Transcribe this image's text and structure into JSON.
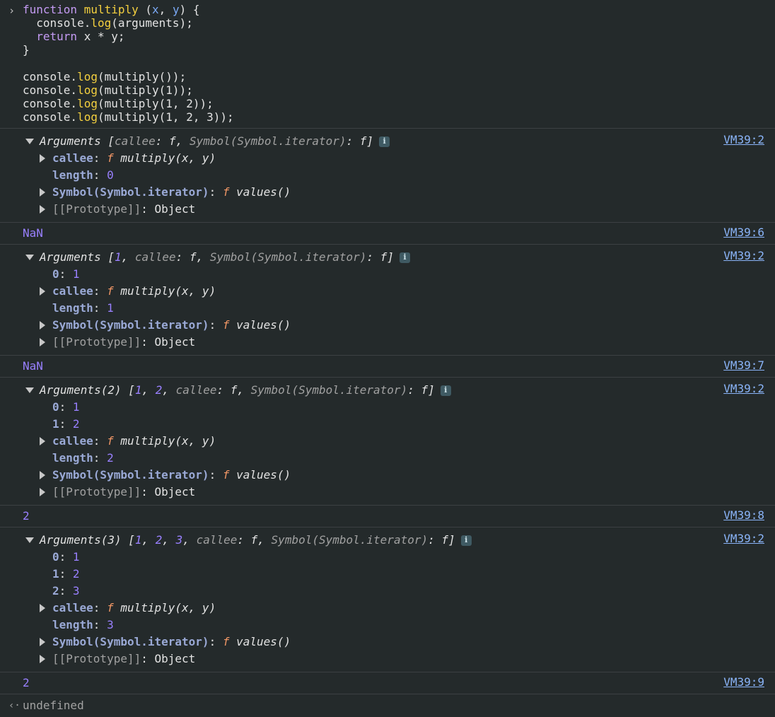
{
  "input": {
    "prompt_glyph": "›",
    "lines": [
      [
        {
          "c": "kw",
          "t": "function "
        },
        {
          "c": "fn",
          "t": "multiply"
        },
        {
          "c": "plain",
          "t": " ("
        },
        {
          "c": "param",
          "t": "x"
        },
        {
          "c": "plain",
          "t": ", "
        },
        {
          "c": "param",
          "t": "y"
        },
        {
          "c": "plain",
          "t": ") {"
        }
      ],
      [
        {
          "c": "plain",
          "t": "  console."
        },
        {
          "c": "fn",
          "t": "log"
        },
        {
          "c": "plain",
          "t": "(arguments);"
        }
      ],
      [
        {
          "c": "plain",
          "t": "  "
        },
        {
          "c": "kw",
          "t": "return"
        },
        {
          "c": "plain",
          "t": " x * y;"
        }
      ],
      [
        {
          "c": "plain",
          "t": "}"
        }
      ],
      [
        {
          "c": "plain",
          "t": ""
        }
      ],
      [
        {
          "c": "plain",
          "t": "console."
        },
        {
          "c": "fn",
          "t": "log"
        },
        {
          "c": "plain",
          "t": "(multiply());"
        }
      ],
      [
        {
          "c": "plain",
          "t": "console."
        },
        {
          "c": "fn",
          "t": "log"
        },
        {
          "c": "plain",
          "t": "(multiply(1));"
        }
      ],
      [
        {
          "c": "plain",
          "t": "console."
        },
        {
          "c": "fn",
          "t": "log"
        },
        {
          "c": "plain",
          "t": "(multiply(1, 2));"
        }
      ],
      [
        {
          "c": "plain",
          "t": "console."
        },
        {
          "c": "fn",
          "t": "log"
        },
        {
          "c": "plain",
          "t": "(multiply(1, 2, 3));"
        }
      ]
    ]
  },
  "strings": {
    "arguments": "Arguments",
    "callee_key": "callee",
    "callee_f": "f",
    "callee_sig": "multiply(x, y)",
    "length_key": "length",
    "symbol_key": "Symbol(Symbol.iterator)",
    "values_f": "f",
    "values_sig": "values()",
    "proto_key": "[[Prototype]]",
    "proto_val": "Object",
    "info": "i"
  },
  "entries": [
    {
      "type": "obj",
      "source": "VM39:2",
      "count_label": "",
      "items": [],
      "length": "0"
    },
    {
      "type": "val",
      "source": "VM39:6",
      "value": "NaN"
    },
    {
      "type": "obj",
      "source": "VM39:2",
      "count_label": "",
      "items": [
        "1"
      ],
      "length": "1"
    },
    {
      "type": "val",
      "source": "VM39:7",
      "value": "NaN"
    },
    {
      "type": "obj",
      "source": "VM39:2",
      "count_label": "(2)",
      "items": [
        "1",
        "2"
      ],
      "length": "2"
    },
    {
      "type": "val",
      "source": "VM39:8",
      "value": "2"
    },
    {
      "type": "obj",
      "source": "VM39:2",
      "count_label": "(3)",
      "items": [
        "1",
        "2",
        "3"
      ],
      "length": "3"
    },
    {
      "type": "val",
      "source": "VM39:9",
      "value": "2"
    }
  ],
  "result": {
    "arrow": "‹·",
    "value": "undefined"
  }
}
